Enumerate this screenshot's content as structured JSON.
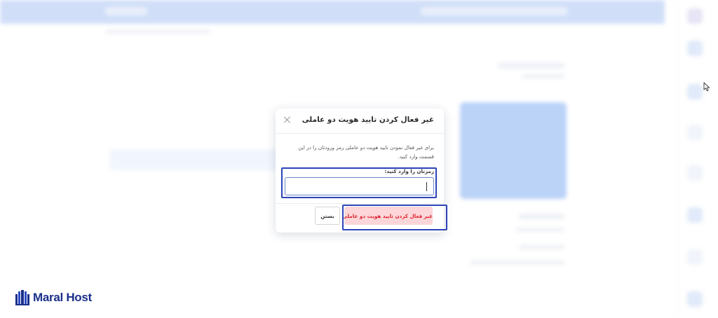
{
  "modal": {
    "title": "غیر فعال کردن تایید هویت دو عاملی",
    "description": "برای غیر فعال نمودن تایید هویت دو عاملی رمز ورودتان را در این قسمت وارد کنید.",
    "field_label": "رمزتان را وارد کنید:",
    "password_value": "",
    "deactivate_label": "غیر فعال کردن تایید هویت دو عاملی",
    "close_label": "بستن"
  },
  "brand": {
    "logo_text": "Maral Host",
    "logo_color": "#1b2f8a",
    "accent_color": "#2c44b8",
    "danger_color": "#e0232f"
  }
}
